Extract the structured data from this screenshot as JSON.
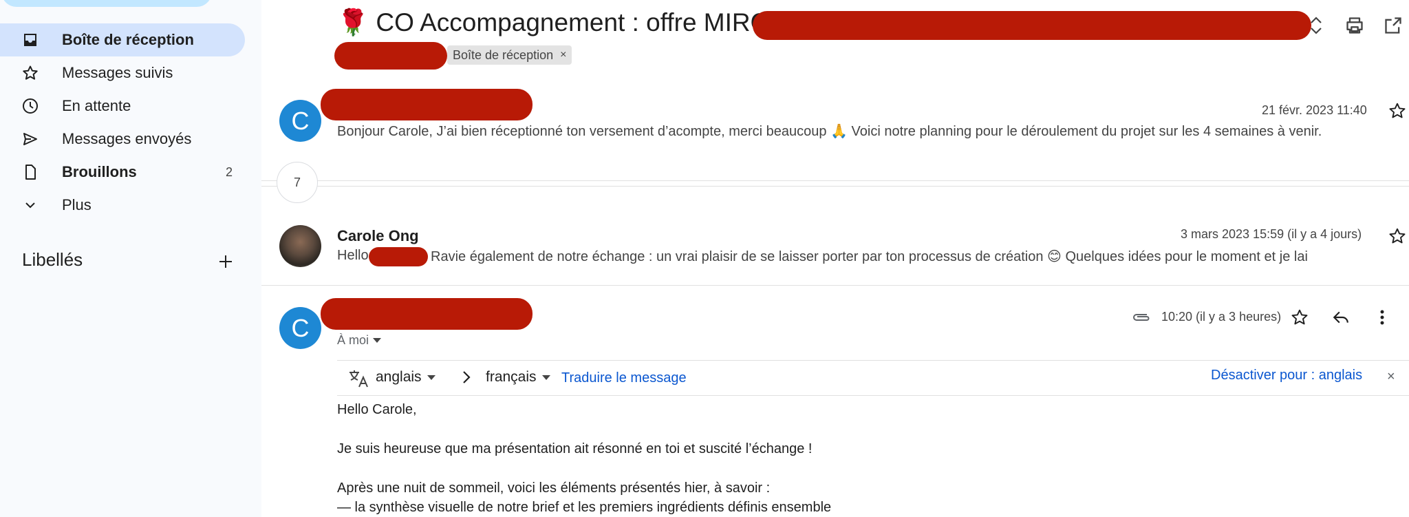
{
  "sidebar": {
    "items": [
      {
        "label": "Boîte de réception",
        "icon": "inbox-icon",
        "active": true
      },
      {
        "label": "Messages suivis",
        "icon": "star-icon"
      },
      {
        "label": "En attente",
        "icon": "clock-icon"
      },
      {
        "label": "Messages envoyés",
        "icon": "send-icon"
      },
      {
        "label": "Brouillons",
        "icon": "draft-icon",
        "count": "2"
      },
      {
        "label": "Plus",
        "icon": "chevron-down-icon"
      }
    ],
    "labels_heading": "Libellés"
  },
  "thread": {
    "subject_emoji": "🌹",
    "subject": "CO Accompagnement : offre MIROIR",
    "label_chip": "Boîte de réception",
    "label_chip_remove": "×"
  },
  "messages": [
    {
      "avatar_letter": "C",
      "date": "21 févr. 2023 11:40",
      "snippet": "Bonjour Carole, J’ai bien réceptionné ton versement d’acompte, merci beaucoup 🙏 Voici notre planning pour le déroulement du projet sur les 4 semaines à venir."
    },
    {
      "collapsed_count": "7"
    },
    {
      "sender": "Carole Ong",
      "date": "3 mars 2023 15:59 (il y a 4 jours)",
      "snippet_start": "Hello",
      "snippet": "Ravie également de notre échange : un vrai plaisir de se laisser porter par ton processus de création 😊 Quelques idées pour le moment et je lai"
    },
    {
      "avatar_letter": "C",
      "date": "10:20 (il y a 3 heures)",
      "to": "À moi"
    }
  ],
  "translate": {
    "from": "anglais",
    "to": "français",
    "action": "Traduire le message",
    "disable": "Désactiver pour : anglais",
    "close": "×"
  },
  "body": {
    "lines": [
      "Hello Carole,",
      "Je suis heureuse que ma présentation ait résonné en toi et suscité l’échange !",
      "Après une nuit de sommeil, voici les éléments présentés hier, à savoir :",
      "— la synthèse visuelle de notre brief et les premiers ingrédients définis ensemble"
    ]
  },
  "colors": {
    "active_nav": "#d3e3fd",
    "avatar": "#1e88d4",
    "link": "#0b57d0",
    "redaction": "#b81a06"
  }
}
